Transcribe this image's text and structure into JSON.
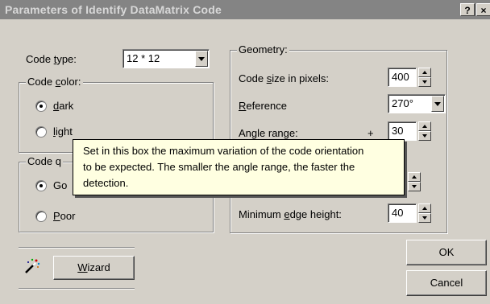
{
  "window": {
    "title": "Parameters of Identify DataMatrix Code",
    "help_label": "?",
    "close_label": "×"
  },
  "code_type": {
    "label": "Code type:",
    "value": "12 * 12"
  },
  "code_color": {
    "title": "Code color:",
    "options": [
      {
        "label": "dark",
        "selected": true
      },
      {
        "label": "light",
        "selected": false
      }
    ]
  },
  "code_quality": {
    "title": "Code q",
    "options": [
      {
        "label": "Go",
        "selected": true
      },
      {
        "label": "Poor",
        "selected": false
      }
    ]
  },
  "geometry": {
    "title": "Geometry:",
    "code_size": {
      "label": "Code size in pixels:",
      "value": "400"
    },
    "reference": {
      "label": "Reference",
      "value": "270°"
    },
    "angle_range": {
      "label": "Angle range:",
      "sign": "+",
      "value": "30"
    },
    "min_edge": {
      "label": "Minimum edge height:",
      "value": "40"
    }
  },
  "tooltip": {
    "lines": [
      "Set in this box the maximum variation of the code orientation",
      "to be expected. The smaller the angle range, the faster the",
      "detection."
    ]
  },
  "buttons": {
    "wizard": "Wizard",
    "ok": "OK",
    "cancel": "Cancel"
  },
  "icons": {
    "wizard": "magic-wand-icon"
  }
}
